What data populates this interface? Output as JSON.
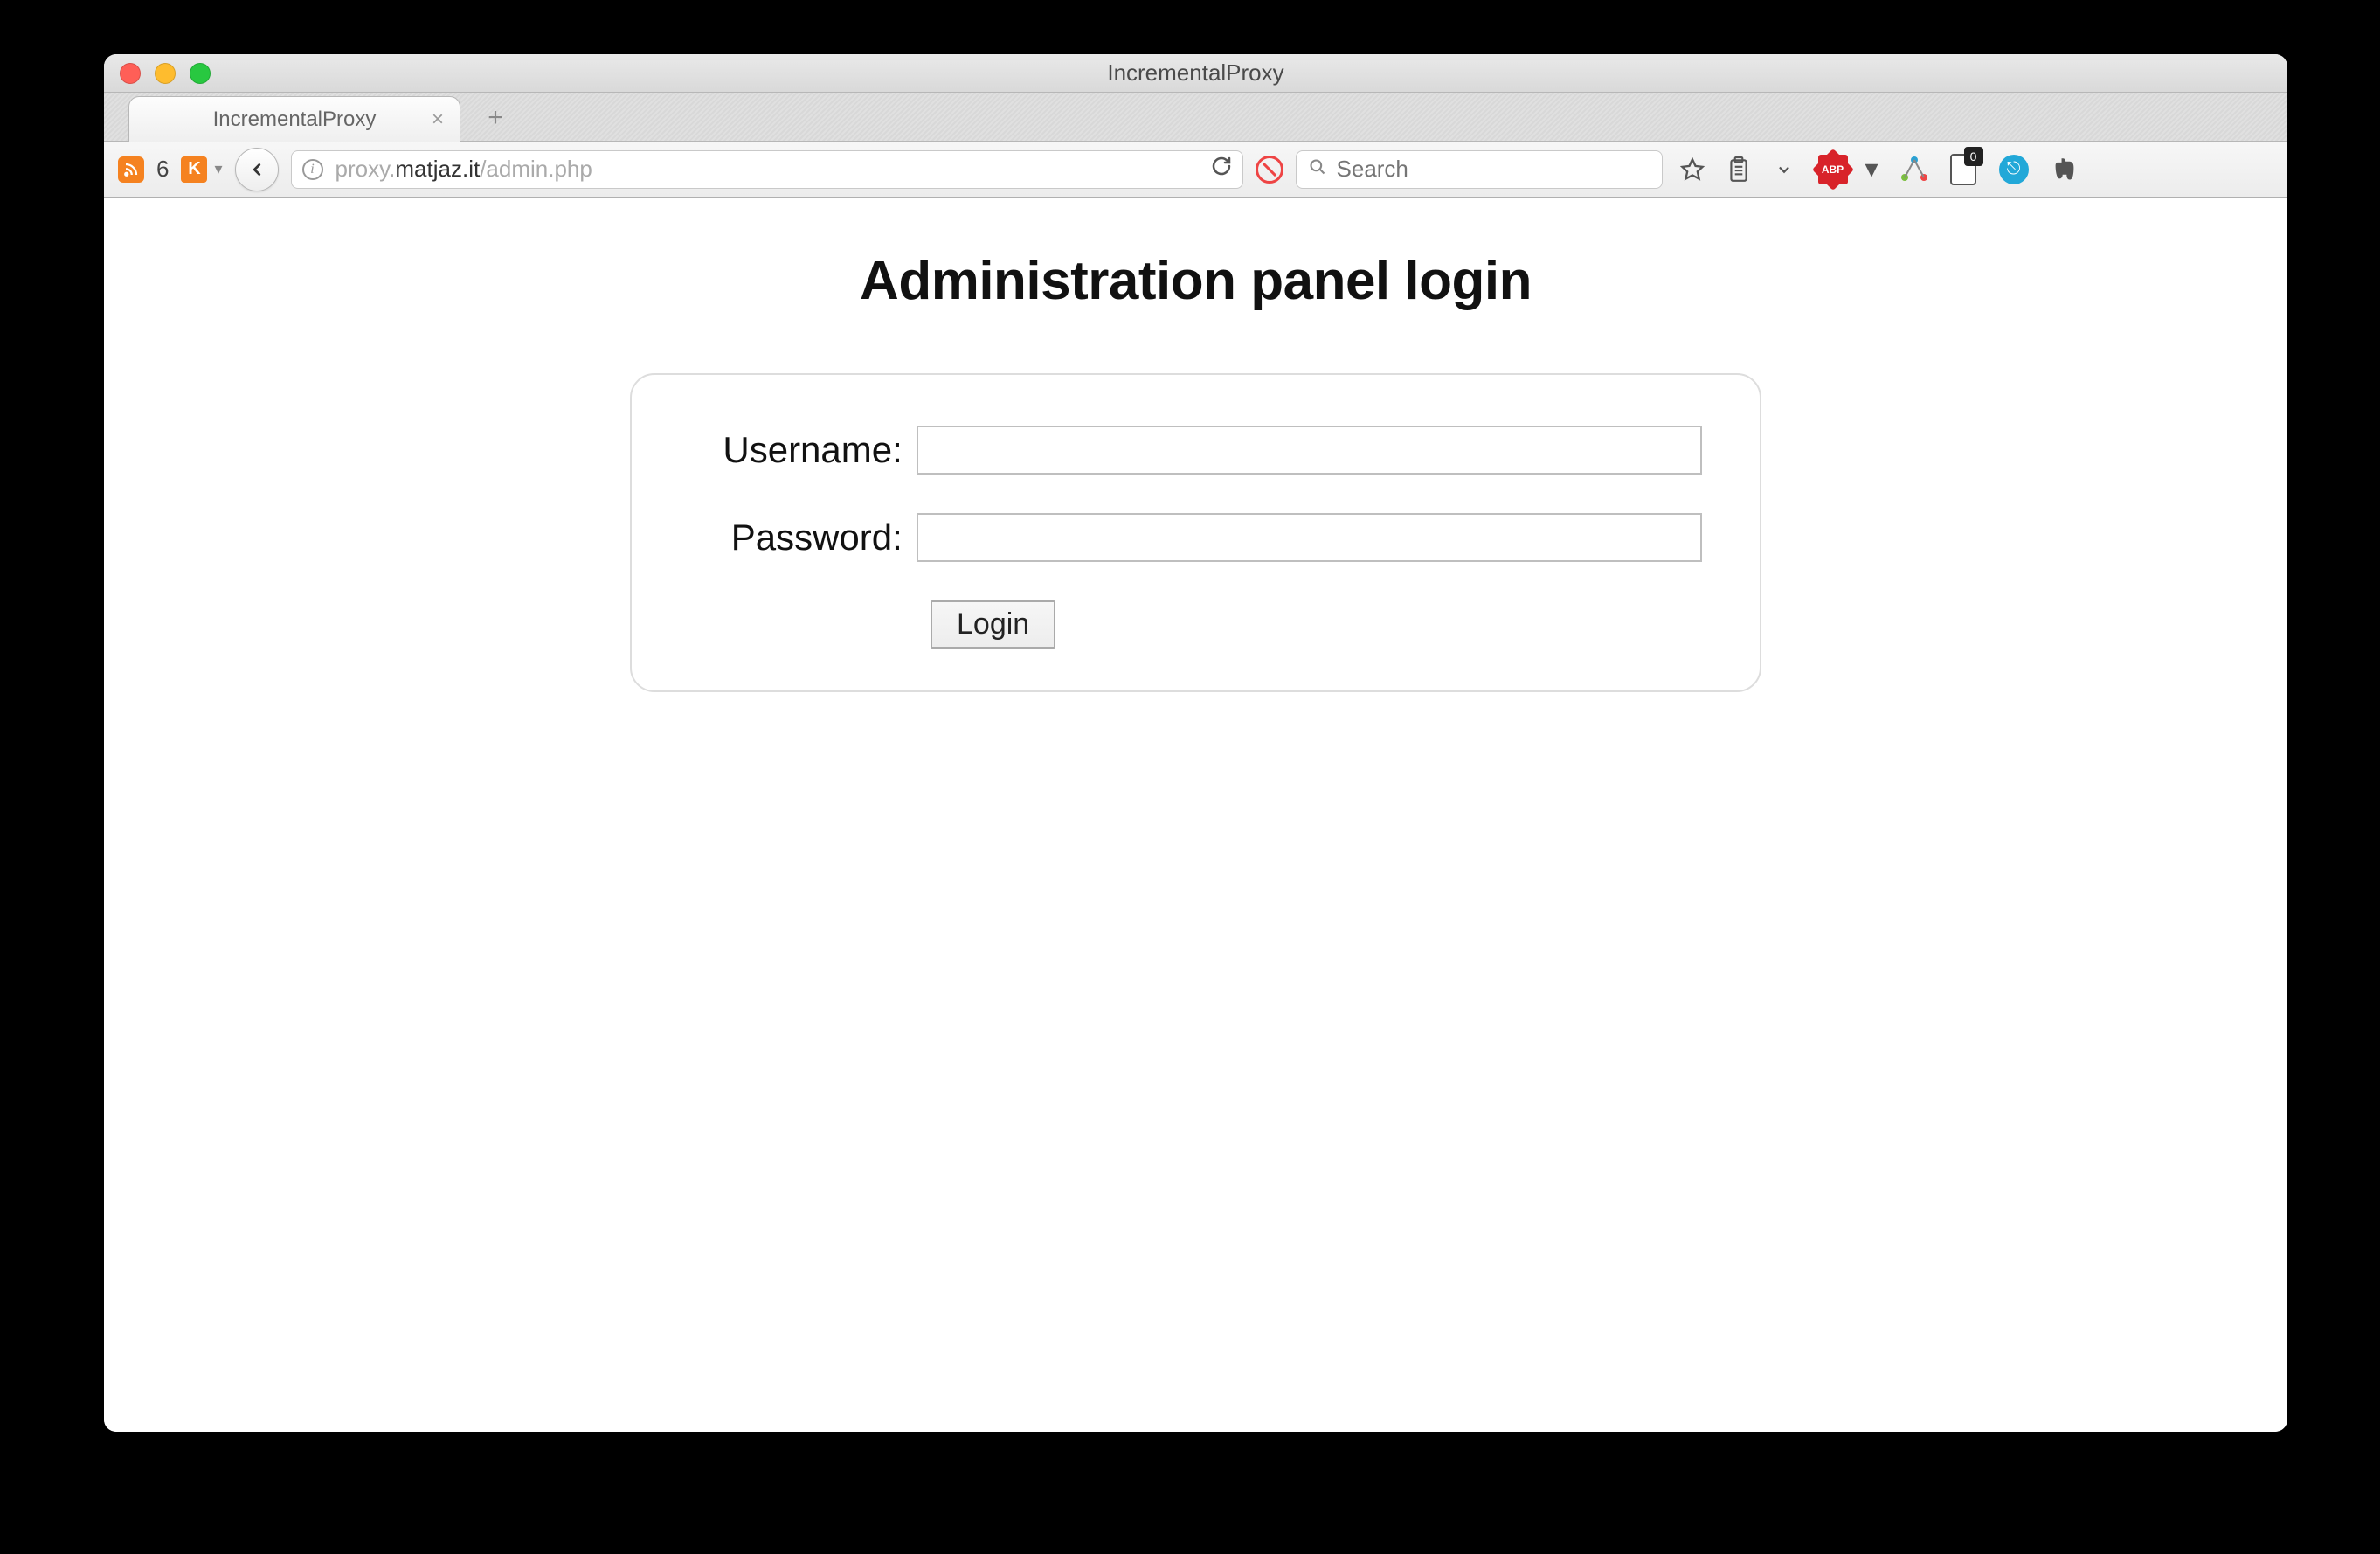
{
  "window_title": "IncrementalProxy",
  "tab": {
    "title": "IncrementalProxy"
  },
  "feed_count": "6",
  "url": {
    "prefix": "proxy.",
    "bold": "matjaz.it",
    "suffix": "/admin.php"
  },
  "search_placeholder": "Search",
  "keep_badge": "0",
  "abp_label": "ABP",
  "page": {
    "heading": "Administration panel login",
    "username_label": "Username:",
    "password_label": "Password:",
    "login_button": "Login"
  }
}
